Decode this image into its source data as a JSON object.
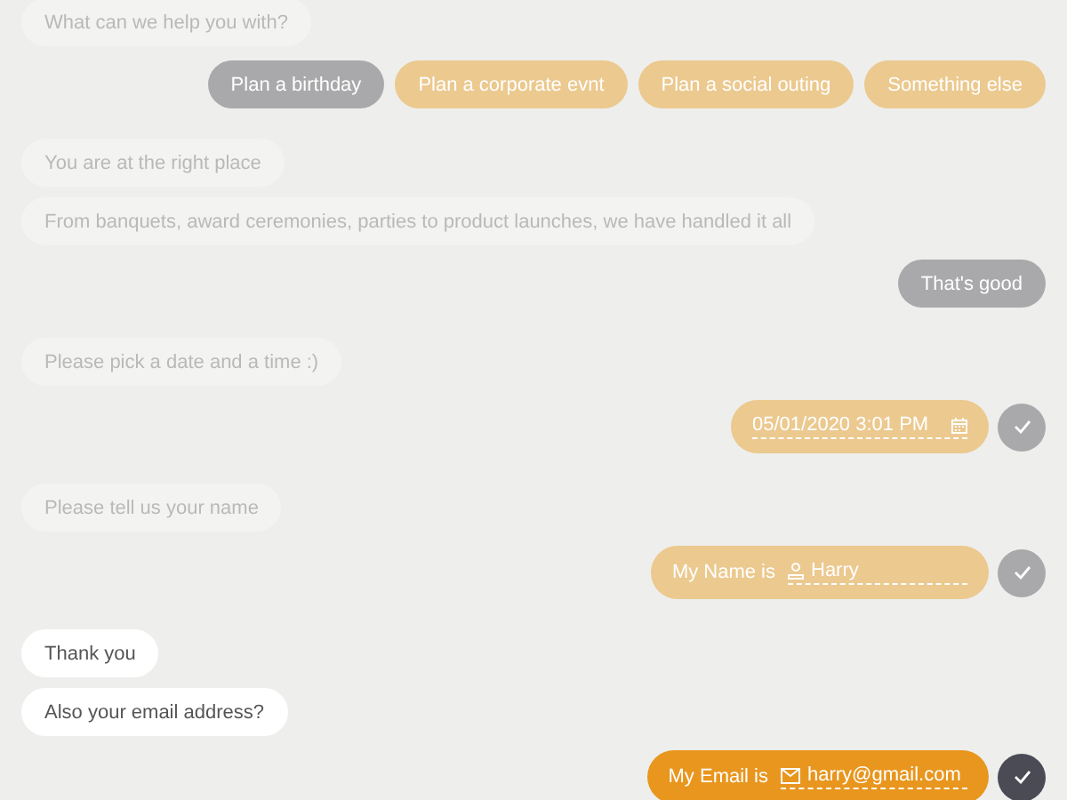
{
  "messages": [
    {
      "kind": "bot",
      "text": "What can we help you with?",
      "faded": true
    },
    {
      "kind": "choices",
      "options": [
        {
          "label": "Plan a birthday",
          "selected": true
        },
        {
          "label": "Plan a corporate evnt",
          "selected": false
        },
        {
          "label": "Plan a social outing",
          "selected": false
        },
        {
          "label": "Something else",
          "selected": false
        }
      ]
    },
    {
      "kind": "bot",
      "text": "You are at the right place",
      "faded": true
    },
    {
      "kind": "bot",
      "text": "From banquets, award ceremonies, parties to product launches, we have handled it all",
      "faded": true
    },
    {
      "kind": "user",
      "text": "That's good"
    },
    {
      "kind": "bot",
      "text": "Please pick a date and a time :)",
      "faded": true
    },
    {
      "kind": "date-field",
      "value": "05/01/2020 3:01 PM",
      "faded": true
    },
    {
      "kind": "bot",
      "text": "Please tell us your name",
      "faded": true
    },
    {
      "kind": "name-field",
      "label": "My Name is",
      "value": "Harry",
      "faded": true
    },
    {
      "kind": "bot",
      "text": "Thank you",
      "faded": false
    },
    {
      "kind": "bot",
      "text": "Also your email address?",
      "faded": false
    },
    {
      "kind": "email-field",
      "label": "My Email is",
      "value": "harry@gmail.com",
      "faded": false
    }
  ]
}
